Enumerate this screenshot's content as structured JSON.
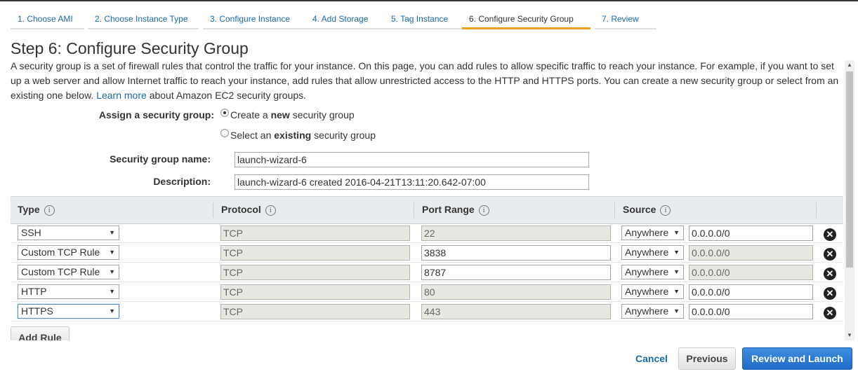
{
  "wizard": {
    "steps": [
      {
        "label": "1. Choose AMI"
      },
      {
        "label": "2. Choose Instance Type"
      },
      {
        "label": "3. Configure Instance"
      },
      {
        "label": "4. Add Storage"
      },
      {
        "label": "5. Tag Instance"
      },
      {
        "label": "6. Configure Security Group"
      },
      {
        "label": "7. Review"
      }
    ],
    "active_step": "6. Configure Security Group"
  },
  "page": {
    "title": "Step 6: Configure Security Group",
    "intro_text": "A security group is a set of firewall rules that control the traffic for your instance. On this page, you can add rules to allow specific traffic to reach your instance. For example, if you want to set up a web server and allow Internet traffic to reach your instance, add rules that allow unrestricted access to the HTTP and HTTPS ports. You can create a new security group or select from an existing one below.",
    "learn_more_link": "Learn more",
    "intro_suffix": "about Amazon EC2 security groups."
  },
  "assign": {
    "label": "Assign a security group:",
    "option_new_pre": "Create a",
    "option_new_bold": "new",
    "option_new_post": "security group",
    "option_existing_pre": "Select an",
    "option_existing_bold": "existing",
    "option_existing_post": "security group",
    "selected": "new"
  },
  "group_name": {
    "label": "Security group name:",
    "value": "launch-wizard-6"
  },
  "description": {
    "label": "Description:",
    "value": "launch-wizard-6 created 2016-04-21T13:11:20.642-07:00"
  },
  "table": {
    "headers": {
      "type": "Type",
      "protocol": "Protocol",
      "port_range": "Port Range",
      "source": "Source",
      "info_glyph": "i"
    },
    "rows": [
      {
        "type": "SSH",
        "protocol": "TCP",
        "port": "22",
        "source": "Anywhere",
        "cidr": "0.0.0.0/0"
      },
      {
        "type": "Custom TCP Rule",
        "protocol": "TCP",
        "port": "3838",
        "source": "Anywhere",
        "cidr": "0.0.0.0/0"
      },
      {
        "type": "Custom TCP Rule",
        "protocol": "TCP",
        "port": "8787",
        "source": "Anywhere",
        "cidr": "0.0.0.0/0"
      },
      {
        "type": "HTTP",
        "protocol": "TCP",
        "port": "80",
        "source": "Anywhere",
        "cidr": "0.0.0.0/0"
      },
      {
        "type": "HTTPS",
        "protocol": "TCP",
        "port": "443",
        "source": "Anywhere",
        "cidr": "0.0.0.0/0"
      }
    ]
  },
  "add_rule_label": "Add Rule",
  "footer": {
    "cancel": "Cancel",
    "previous": "Previous",
    "review_launch": "Review and Launch"
  },
  "glyphs": {
    "caret": "▼",
    "remove": "✕",
    "scroll_up": "▲",
    "scroll_down": "▼"
  },
  "colors": {
    "link": "#1a6aa8",
    "active_tab": "#f0a020",
    "primary_button": "#1f6bc7"
  }
}
